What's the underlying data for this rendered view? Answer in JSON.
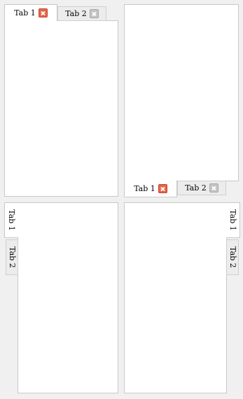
{
  "panels": {
    "top_left": {
      "tabs": [
        {
          "label": "Tab 1",
          "active": true,
          "close_icon": "close-icon"
        },
        {
          "label": "Tab 2",
          "active": false,
          "close_icon": "close-icon"
        }
      ],
      "tab_position": "top"
    },
    "top_right": {
      "tabs": [
        {
          "label": "Tab 1",
          "active": true,
          "close_icon": "close-icon"
        },
        {
          "label": "Tab 2",
          "active": false,
          "close_icon": "close-icon"
        }
      ],
      "tab_position": "bottom"
    },
    "bottom_left": {
      "tabs": [
        {
          "label": "Tab 1",
          "active": true
        },
        {
          "label": "Tab 2",
          "active": false
        }
      ],
      "tab_position": "left"
    },
    "bottom_right": {
      "tabs": [
        {
          "label": "Tab 1",
          "active": true
        },
        {
          "label": "Tab 2",
          "active": false
        }
      ],
      "tab_position": "right"
    }
  },
  "colors": {
    "window_bg": "#f0f0f0",
    "pane_bg": "#ffffff",
    "border": "#c8c8c8",
    "close_active": "#e8664a",
    "close_inactive": "#c4c4c4"
  }
}
